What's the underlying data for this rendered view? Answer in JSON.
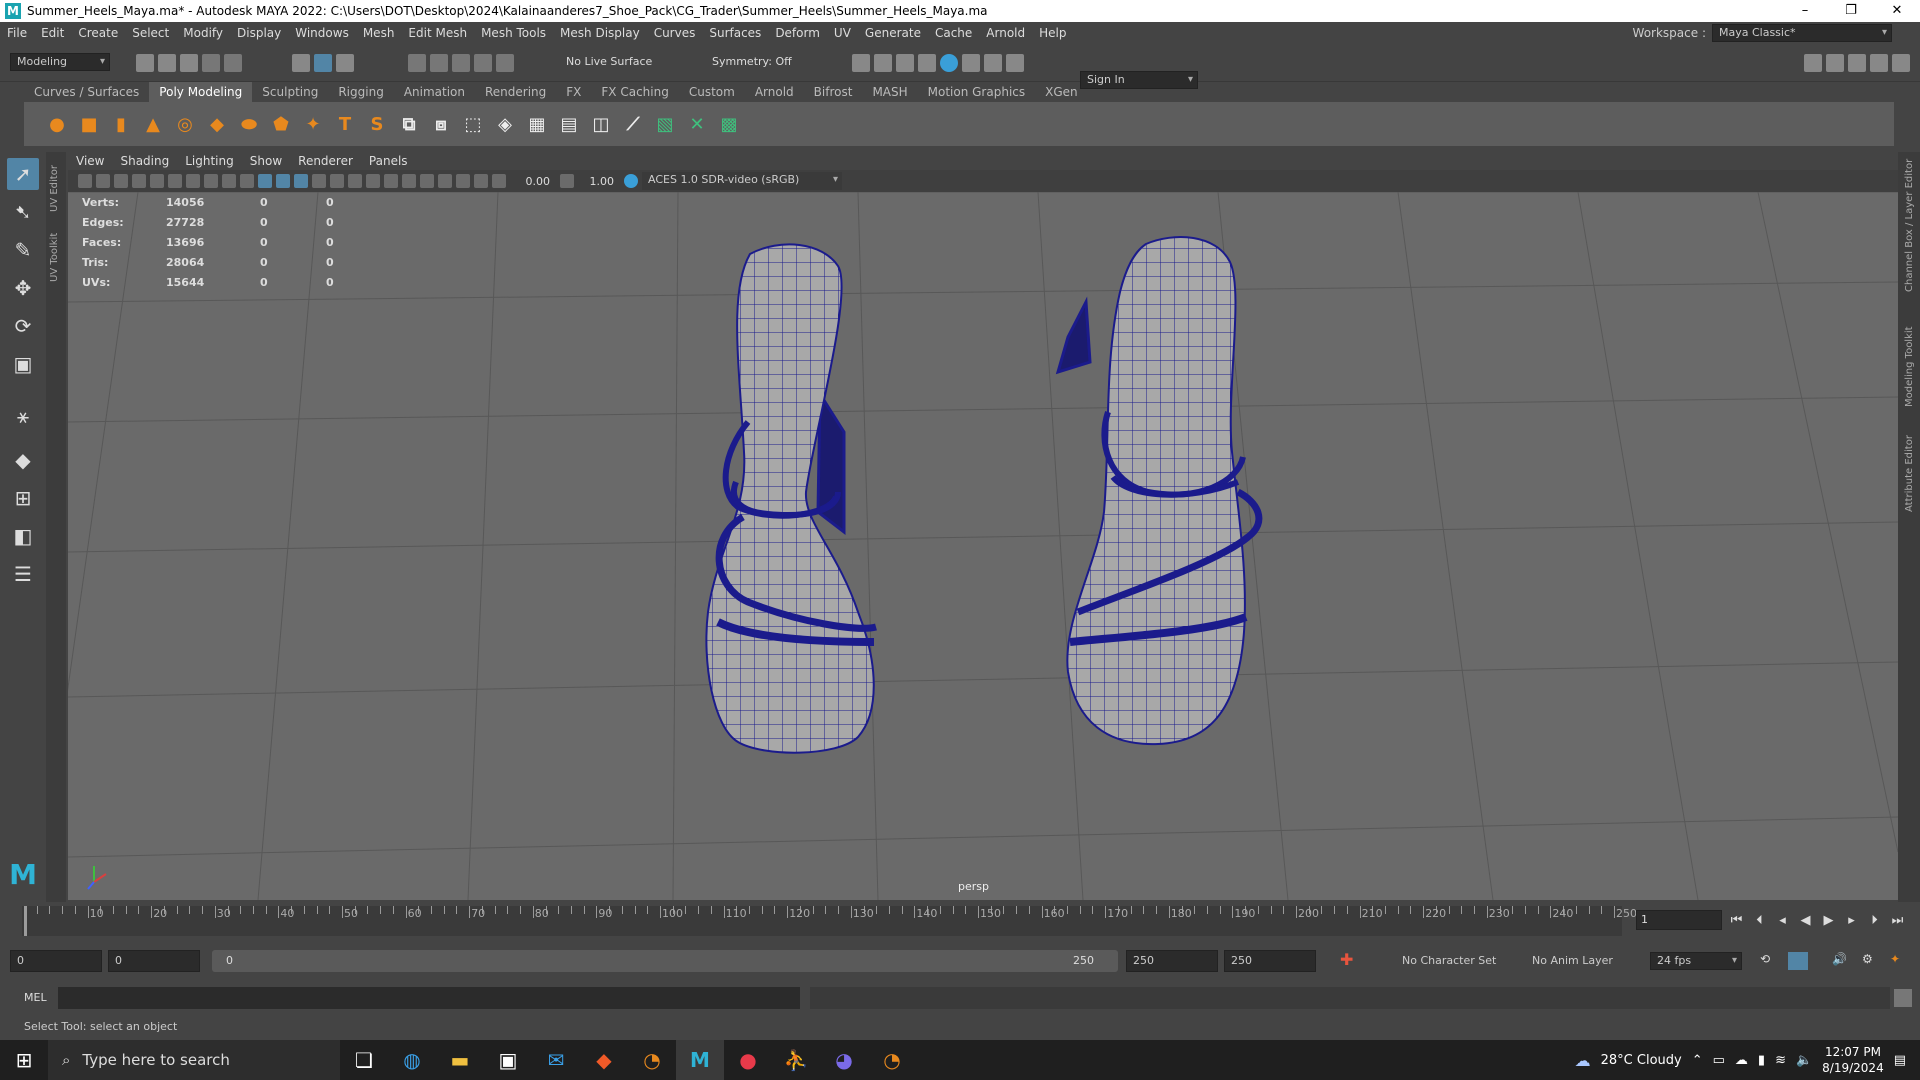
{
  "window": {
    "title": "Summer_Heels_Maya.ma* - Autodesk MAYA 2022: C:\\Users\\DOT\\Desktop\\2024\\Kalainaanderes7_Shoe_Pack\\CG_Trader\\Summer_Heels\\Summer_Heels_Maya.ma",
    "minimize": "–",
    "maximize": "❐",
    "close": "✕"
  },
  "menus": [
    "File",
    "Edit",
    "Create",
    "Select",
    "Modify",
    "Display",
    "Windows",
    "Mesh",
    "Edit Mesh",
    "Mesh Tools",
    "Mesh Display",
    "Curves",
    "Surfaces",
    "Deform",
    "UV",
    "Generate",
    "Cache",
    "Arnold",
    "Help"
  ],
  "workspace": {
    "label": "Workspace :",
    "value": "Maya Classic*"
  },
  "statusline": {
    "mode": "Modeling",
    "live_surface": "No Live Surface",
    "symmetry": "Symmetry: Off",
    "sign_in": "Sign In"
  },
  "shelf_tabs": [
    "Curves / Surfaces",
    "Poly Modeling",
    "Sculpting",
    "Rigging",
    "Animation",
    "Rendering",
    "FX",
    "FX Caching",
    "Custom",
    "Arnold",
    "Bifrost",
    "MASH",
    "Motion Graphics",
    "XGen"
  ],
  "shelf_active": "Poly Modeling",
  "shelf_icons": [
    "sphere-icon",
    "cube-icon",
    "cylinder-icon",
    "cone-icon",
    "torus-icon",
    "plane-icon",
    "disc-icon",
    "platonic-icon",
    "super-shape-icon",
    "type-icon",
    "svg-icon",
    "combine-icon",
    "separate-icon",
    "extract-icon",
    "bevel-icon",
    "bridge-icon",
    "extrude-icon",
    "fill-hole-icon",
    "multi-cut-icon",
    "quad-draw-icon",
    "target-weld-icon",
    "uv-editor-icon"
  ],
  "side_tabs": [
    "UV Editor",
    "UV Toolkit"
  ],
  "right_tabs": [
    "Channel Box / Layer Editor",
    "Modeling Toolkit",
    "Attribute Editor"
  ],
  "panel_menu": [
    "View",
    "Shading",
    "Lighting",
    "Show",
    "Renderer",
    "Panels"
  ],
  "panel_toolbar": {
    "exposure": "0.00",
    "gamma": "1.00",
    "color_space": "ACES 1.0 SDR-video (sRGB)"
  },
  "hud": [
    {
      "label": "Verts:",
      "value": "14056",
      "a": "0",
      "b": "0"
    },
    {
      "label": "Edges:",
      "value": "27728",
      "a": "0",
      "b": "0"
    },
    {
      "label": "Faces:",
      "value": "13696",
      "a": "0",
      "b": "0"
    },
    {
      "label": "Tris:",
      "value": "28064",
      "a": "0",
      "b": "0"
    },
    {
      "label": "UVs:",
      "value": "15644",
      "a": "0",
      "b": "0"
    }
  ],
  "camera": "persp",
  "timeline": {
    "ticks": [
      "10",
      "20",
      "30",
      "40",
      "50",
      "60",
      "70",
      "80",
      "90",
      "100",
      "110",
      "120",
      "130",
      "140",
      "150",
      "160",
      "170",
      "180",
      "190",
      "200",
      "210",
      "220",
      "230",
      "240",
      "250"
    ],
    "current_frame": "1"
  },
  "range": {
    "start": "0",
    "anim_start": "0",
    "slider_start": "0",
    "slider_end": "250",
    "anim_end": "250",
    "end": "250",
    "character_set": "No Character Set",
    "anim_layer": "No Anim Layer",
    "fps": "24 fps"
  },
  "cmdline": {
    "language": "MEL"
  },
  "help_line": "Select Tool: select an object",
  "taskbar": {
    "search_placeholder": "Type here to search",
    "weather": "28°C Cloudy",
    "time": "12:07 PM",
    "date": "8/19/2024"
  },
  "colors": {
    "viewport": "#6a6a6a",
    "wireframe": "#1b1b8c",
    "selected_tool": "#5285a6",
    "shelf_icon_orange": "#e8891e"
  }
}
